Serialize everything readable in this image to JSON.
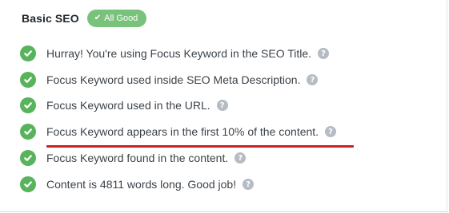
{
  "section": {
    "title": "Basic SEO",
    "status_badge": {
      "icon": "check-icon",
      "label": "All Good",
      "color": "#78c27c"
    }
  },
  "checks": [
    {
      "icon": "check-circle-icon",
      "text": "Hurray! You're using Focus Keyword in the SEO Title.",
      "status": "pass"
    },
    {
      "icon": "check-circle-icon",
      "text": "Focus Keyword used inside SEO Meta Description.",
      "status": "pass"
    },
    {
      "icon": "check-circle-icon",
      "text": "Focus Keyword used in the URL.",
      "status": "pass"
    },
    {
      "icon": "check-circle-icon",
      "text": "Focus Keyword appears in the first 10% of the content.",
      "status": "pass"
    },
    {
      "icon": "check-circle-icon",
      "text": "Focus Keyword found in the content.",
      "status": "pass"
    },
    {
      "icon": "check-circle-icon",
      "text": "Content is 4811 words long. Good job!",
      "status": "pass"
    }
  ],
  "help_icon": {
    "icon": "question-mark-icon",
    "glyph": "?"
  },
  "colors": {
    "pass": "#58b35d",
    "help": "#b6bcc3",
    "highlight_underline": "#cc1f26"
  }
}
